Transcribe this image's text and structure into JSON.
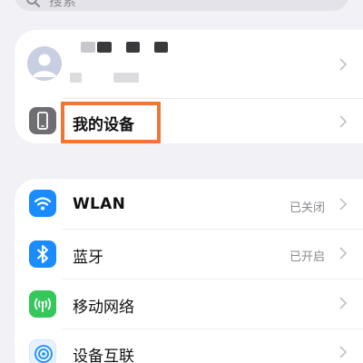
{
  "search": {
    "placeholder_visible": "搜索",
    "icon": "search-icon"
  },
  "profile": {
    "icon": "avatar-icon"
  },
  "my_device": {
    "label": "我的设备",
    "icon": "phone-icon",
    "highlight_color": "#ef7637"
  },
  "settings": [
    {
      "label": "WLAN",
      "value": "已关闭",
      "icon": "wifi-icon",
      "color": "#1a8cff"
    },
    {
      "label": "蓝牙",
      "value": "已开启",
      "icon": "bluetooth-icon",
      "color": "#1a8cff"
    },
    {
      "label": "移动网络",
      "value": "",
      "icon": "mobile-network-icon",
      "color": "#34c759"
    },
    {
      "label": "设备互联",
      "value": "",
      "icon": "device-connect-icon",
      "color": "#1a8cff"
    }
  ],
  "colors": {
    "background": "#f1f1f6",
    "card": "#ffffff",
    "secondary_text": "#8a8a8f",
    "chevron": "#c4c4c8"
  }
}
